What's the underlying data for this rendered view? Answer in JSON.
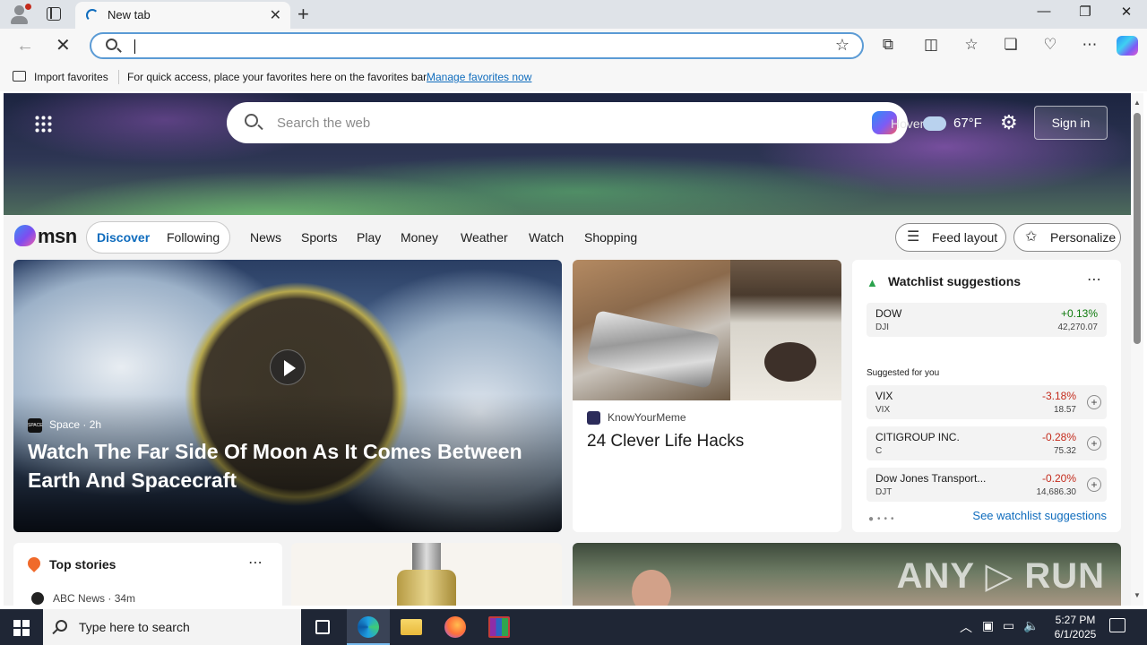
{
  "browser": {
    "tab_title": "New tab",
    "new_tab_symbol": "+",
    "close_tab_symbol": "✕",
    "window_controls": {
      "minimize": "—",
      "restore": "❐",
      "close": "✕"
    },
    "address_bar": {
      "value": "",
      "placeholder": ""
    },
    "icons": [
      "back-arrow-icon",
      "stop-icon",
      "search-icon",
      "favorite-star-icon",
      "extensions-icon",
      "split-screen-icon",
      "favorites-icon",
      "collections-icon",
      "browser-essentials-icon",
      "more-icon",
      "copilot-icon"
    ]
  },
  "favorites_bar": {
    "import_label": "Import favorites",
    "message": "For quick access, place your favorites here on the favorites bar.",
    "manage_link": "Manage favorites now"
  },
  "msn": {
    "search_placeholder": "Search the web",
    "hover_text": "Hover",
    "weather_temp": "67°F",
    "sign_in": "Sign in",
    "logo_text": "msn",
    "feed_tabs": [
      "Discover",
      "Following"
    ],
    "nav_links": [
      "News",
      "Sports",
      "Play",
      "Money",
      "Weather",
      "Watch",
      "Shopping"
    ],
    "feed_layout": "Feed layout",
    "personalize": "Personalize"
  },
  "cards": {
    "hero": {
      "source": "Space",
      "source_logo": "SPACE",
      "age": "2h",
      "headline": "Watch The Far Side Of Moon As It Comes Between Earth And Spacecraft"
    },
    "life_hacks": {
      "source": "KnowYourMeme",
      "headline": "24 Clever Life Hacks"
    },
    "top_stories": {
      "heading": "Top stories",
      "source": "ABC News",
      "age": "34m"
    }
  },
  "watchlist": {
    "title": "Watchlist suggestions",
    "suggested_label": "Suggested for you",
    "see_link": "See watchlist suggestions",
    "items": [
      {
        "name": "DOW",
        "symbol": "DJI",
        "change": "+0.13%",
        "price": "42,270.07",
        "direction": "up"
      },
      {
        "name": "VIX",
        "symbol": "VIX",
        "change": "-3.18%",
        "price": "18.57",
        "direction": "down"
      },
      {
        "name": "CITIGROUP INC.",
        "symbol": "C",
        "change": "-0.28%",
        "price": "75.32",
        "direction": "down"
      },
      {
        "name": "Dow Jones Transport...",
        "symbol": "DJT",
        "change": "-0.20%",
        "price": "14,686.30",
        "direction": "down"
      }
    ]
  },
  "watermark": "ANY ▷ RUN",
  "taskbar": {
    "search_placeholder": "Type here to search",
    "time": "5:27 PM",
    "date": "6/1/2025"
  },
  "colors": {
    "accent": "#0f6cbd",
    "positive": "#0e7a0d",
    "negative": "#c42b1c",
    "taskbar": "#1f2635"
  }
}
